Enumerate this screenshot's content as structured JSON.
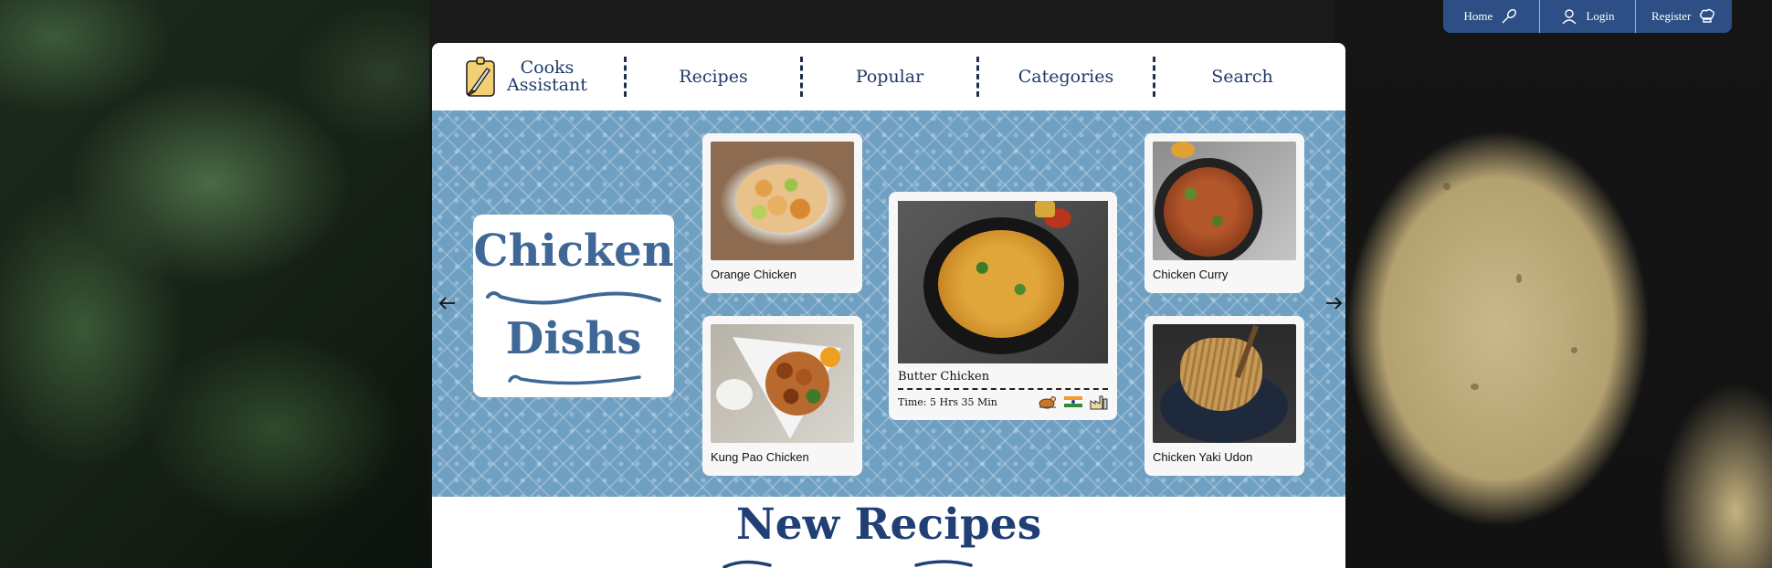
{
  "auth": {
    "items": [
      {
        "label": "Home",
        "icon": "whisk-icon"
      },
      {
        "label": "Login",
        "icon": "user-icon"
      },
      {
        "label": "Register",
        "icon": "chef-hat-icon"
      }
    ]
  },
  "brand": {
    "line1": "Cooks",
    "line2": "Assistant",
    "icon": "cutting-board-knife-icon"
  },
  "nav": {
    "items": [
      "Recipes",
      "Popular",
      "Categories",
      "Search"
    ]
  },
  "hero": {
    "title_line1": "Chicken",
    "title_line2": "Dishs",
    "cards": [
      {
        "label": "Orange Chicken"
      },
      {
        "label": "Kung Pao Chicken"
      },
      {
        "label": "Chicken Curry"
      },
      {
        "label": "Chicken Yaki Udon"
      }
    ],
    "featured": {
      "name": "Butter Chicken",
      "time": "Time: 5 Hrs 35 Min",
      "icons": [
        "roast-chicken-icon",
        "india-flag-icon",
        "factory-icon"
      ]
    }
  },
  "section": {
    "title": "New Recipes"
  },
  "colors": {
    "brand_blue": "#2d4f86",
    "hero_blue": "#6f9fc1",
    "title_blue": "#3f6896"
  }
}
